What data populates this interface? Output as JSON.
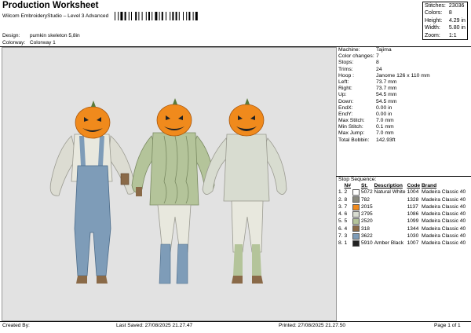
{
  "header": {
    "title": "Production Worksheet",
    "subtitle": "Wilcom EmbroideryStudio – Level 3 Advanced"
  },
  "stats": [
    {
      "label": "Stitches:",
      "value": "23036"
    },
    {
      "label": "Colors:",
      "value": "8"
    },
    {
      "label": "Height:",
      "value": "4.29 in"
    },
    {
      "label": "Width:",
      "value": "5.80 in"
    },
    {
      "label": "Zoom:",
      "value": "1:1"
    }
  ],
  "design": {
    "label": "Design:",
    "value": "pumkin skeleton 5,8in"
  },
  "colorway": {
    "label": "Colorway:",
    "value": "Colorway 1"
  },
  "specs": [
    {
      "k": "Machine:",
      "v": "Tajima"
    },
    {
      "k": "Color changes:",
      "v": "7"
    },
    {
      "k": "Stops:",
      "v": "8"
    },
    {
      "k": "Trims:",
      "v": "24"
    },
    {
      "k": "Hoop :",
      "v": "Janome 126 x 110 mm"
    },
    {
      "k": "Left:",
      "v": "73.7 mm"
    },
    {
      "k": "Right:",
      "v": "73.7 mm"
    },
    {
      "k": "Up:",
      "v": "54.5 mm"
    },
    {
      "k": "Down:",
      "v": "54.5 mm"
    },
    {
      "k": "EndX:",
      "v": "0.00 in"
    },
    {
      "k": "EndY:",
      "v": "0.00 in"
    },
    {
      "k": "Max Stitch:",
      "v": "7.0 mm"
    },
    {
      "k": "Min Stitch:",
      "v": "0.1 mm"
    },
    {
      "k": "Max Jump:",
      "v": "7.0 mm"
    },
    {
      "k": "Total Bobbin:",
      "v": "142.93ft"
    }
  ],
  "sequence": {
    "title": "Stop Sequence:",
    "headers": {
      "n": "N#",
      "st": "St.",
      "desc": "Description",
      "code": "Code",
      "brand": "Brand"
    },
    "rows": [
      {
        "idx": "1.",
        "n": "2",
        "color": "#ffffff",
        "st": "5072",
        "desc": "Natural White",
        "code": "1004",
        "brand": "Madeira Classic 40"
      },
      {
        "idx": "2.",
        "n": "8",
        "color": "#8a8a7e",
        "st": "782",
        "desc": "",
        "code": "1328",
        "brand": "Madeira Classic 40"
      },
      {
        "idx": "3.",
        "n": "7",
        "color": "#f08a1c",
        "st": "2015",
        "desc": "",
        "code": "1137",
        "brand": "Madeira Classic 40"
      },
      {
        "idx": "4.",
        "n": "6",
        "color": "#d8dcd0",
        "st": "2795",
        "desc": "",
        "code": "1086",
        "brand": "Madeira Classic 40"
      },
      {
        "idx": "5.",
        "n": "5",
        "color": "#b4c49a",
        "st": "2520",
        "desc": "",
        "code": "1099",
        "brand": "Madeira Classic 40"
      },
      {
        "idx": "6.",
        "n": "4",
        "color": "#8a6a48",
        "st": "318",
        "desc": "",
        "code": "1344",
        "brand": "Madeira Classic 40"
      },
      {
        "idx": "7.",
        "n": "3",
        "color": "#7e9cb8",
        "st": "3622",
        "desc": "",
        "code": "1030",
        "brand": "Madeira Classic 40"
      },
      {
        "idx": "8.",
        "n": "1",
        "color": "#222222",
        "st": "5910",
        "desc": "Amber Black",
        "code": "1007",
        "brand": "Madeira Classic 40"
      }
    ]
  },
  "footer": {
    "created": "Created By:",
    "saved": "Last Saved: 27/08/2025 21.27.47",
    "printed": "Printed: 27/08/2025 21.27.50",
    "page": "Page 1 of 1"
  },
  "colors": {
    "canvas": "#e2e2e2",
    "pumpkin": "#f08a1c",
    "denim": "#7e9cb8",
    "sweater": "#b4c49a"
  }
}
